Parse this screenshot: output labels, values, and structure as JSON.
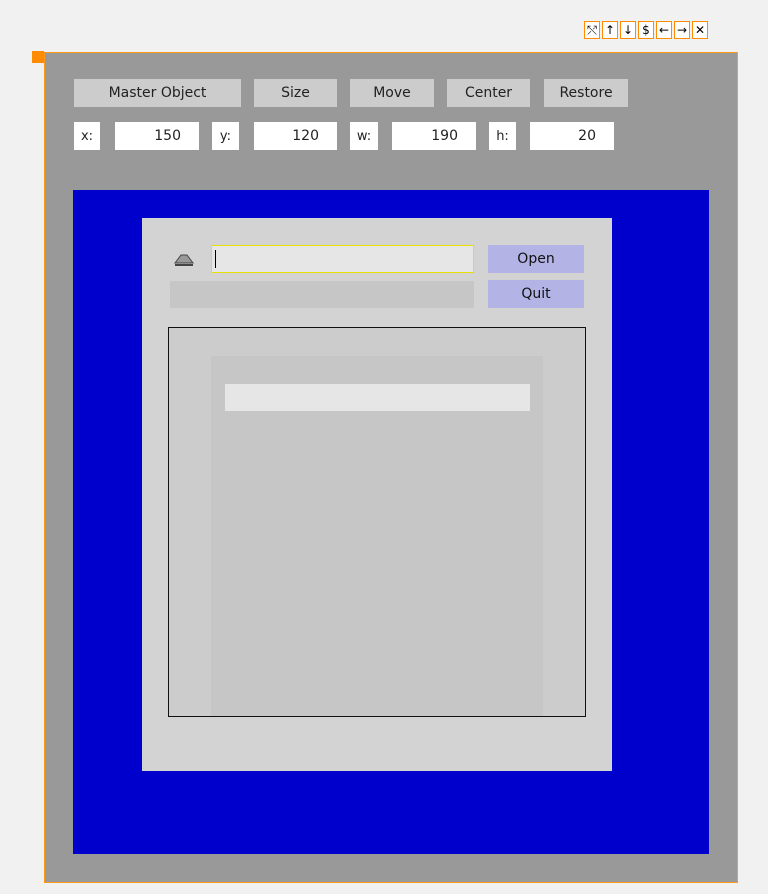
{
  "window_controls": [
    {
      "name": "resize-icon",
      "glyph": "⤲"
    },
    {
      "name": "arrow-up-icon",
      "glyph": "↑"
    },
    {
      "name": "arrow-down-icon",
      "glyph": "↓"
    },
    {
      "name": "dollar-icon",
      "glyph": "$"
    },
    {
      "name": "arrow-left-icon",
      "glyph": "←"
    },
    {
      "name": "arrow-right-icon",
      "glyph": "→"
    },
    {
      "name": "close-icon",
      "glyph": "✕"
    }
  ],
  "toolbar": {
    "master_object_label": "Master Object",
    "size_label": "Size",
    "move_label": "Move",
    "center_label": "Center",
    "restore_label": "Restore"
  },
  "geometry_fields": {
    "x_label": "x:",
    "x_value": "150",
    "y_label": "y:",
    "y_value": "120",
    "w_label": "w:",
    "w_value": "190",
    "h_label": "h:",
    "h_value": "20"
  },
  "file_dialog": {
    "path_value": "",
    "status_text": "",
    "open_label": "Open",
    "quit_label": "Quit",
    "list_items": [
      ""
    ]
  },
  "colors": {
    "accent_orange": "#ff8c00",
    "stage_blue": "#0000cc",
    "action_button": "#b3b3e6"
  }
}
